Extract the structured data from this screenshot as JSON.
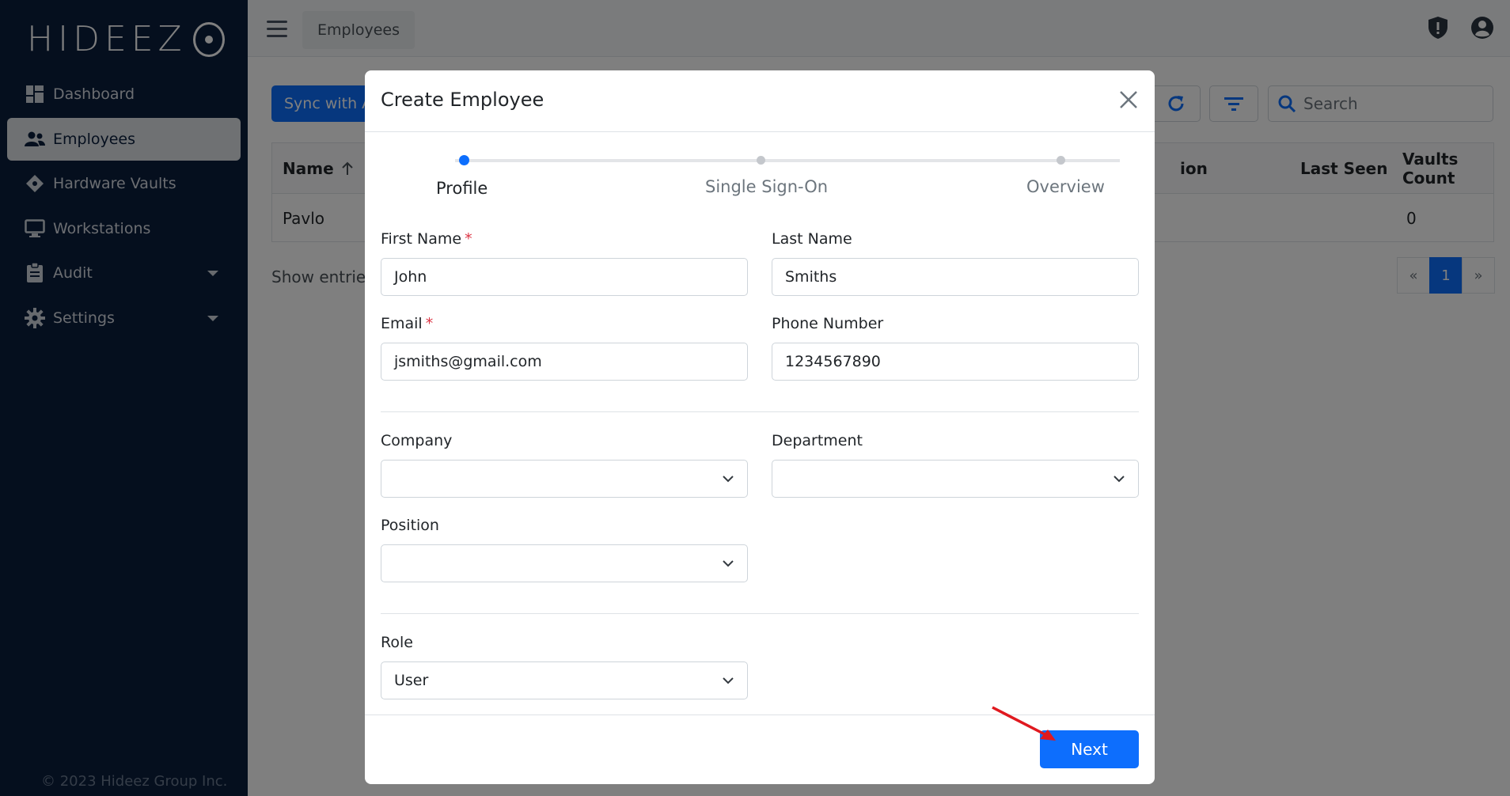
{
  "app": {
    "logo": "HIDEEZ",
    "copyright": "© 2023 Hideez Group Inc."
  },
  "sidebar": {
    "items": [
      {
        "label": "Dashboard",
        "icon": "dashboard-icon"
      },
      {
        "label": "Employees",
        "icon": "users-icon"
      },
      {
        "label": "Hardware Vaults",
        "icon": "vault-icon"
      },
      {
        "label": "Workstations",
        "icon": "monitor-icon"
      },
      {
        "label": "Audit",
        "icon": "clipboard-icon"
      },
      {
        "label": "Settings",
        "icon": "gear-icon"
      }
    ]
  },
  "topbar": {
    "breadcrumb": "Employees"
  },
  "page": {
    "sync_label": "Sync with Active Directory",
    "search_placeholder": "Search",
    "table": {
      "headers": {
        "name": "Name",
        "position": "ion",
        "last_seen": "Last Seen",
        "vaults_count": "Vaults Count"
      },
      "rows": [
        {
          "name": "Pavlo",
          "vaults_count": "0"
        }
      ]
    },
    "show_entries": "Show entries",
    "pager": {
      "prev": "«",
      "current": "1",
      "next": "»"
    }
  },
  "modal": {
    "title": "Create Employee",
    "steps": [
      "Profile",
      "Single Sign-On",
      "Overview"
    ],
    "fields": {
      "first_name": {
        "label": "First Name",
        "value": "John",
        "required": "*"
      },
      "last_name": {
        "label": "Last Name",
        "value": "Smiths"
      },
      "email": {
        "label": "Email",
        "value": "jsmiths@gmail.com",
        "required": "*"
      },
      "phone": {
        "label": "Phone Number",
        "value": "1234567890"
      },
      "company": {
        "label": "Company",
        "value": ""
      },
      "department": {
        "label": "Department",
        "value": ""
      },
      "position": {
        "label": "Position",
        "value": ""
      },
      "role": {
        "label": "Role",
        "value": "User"
      }
    },
    "next_label": "Next"
  },
  "colors": {
    "primary": "#0d6efd",
    "sidebar": "#0a1e3d",
    "required": "#dc3545",
    "annotation": "#e0191f"
  }
}
